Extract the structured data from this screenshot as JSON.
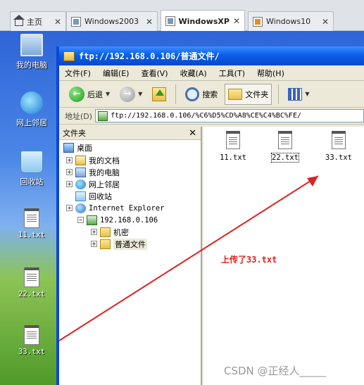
{
  "vm_tabs": [
    {
      "label": "主页",
      "icon": "home-icon"
    },
    {
      "label": "Windows2003",
      "icon": "vm-icon"
    },
    {
      "label": "WindowsXP",
      "icon": "vm-icon",
      "active": true
    },
    {
      "label": "Windows10",
      "icon": "vm-icon"
    }
  ],
  "desktop": {
    "icons": [
      "我的电脑",
      "网上邻居",
      "回收站",
      "11.txt",
      "22.txt",
      "33.txt"
    ]
  },
  "window": {
    "title": "ftp://192.168.0.106/普通文件/",
    "menu": [
      "文件(F)",
      "编辑(E)",
      "查看(V)",
      "收藏(A)",
      "工具(T)",
      "帮助(H)"
    ],
    "toolbar": {
      "back": "后退",
      "search": "搜索",
      "folders": "文件夹"
    },
    "address": {
      "label": "地址(D)",
      "value": "ftp://192.168.0.106/%C6%D5%CD%A8%CE%C4%BC%FE/"
    }
  },
  "tree": {
    "header": "文件夹",
    "nodes": [
      "桌面",
      "我的文档",
      "我的电脑",
      "网上邻居",
      "回收站",
      "Internet Explorer",
      "192.168.0.106",
      "机密",
      "普通文件"
    ]
  },
  "files": [
    "11.txt",
    "22.txt",
    "33.txt"
  ],
  "annotation": "上传了33.txt",
  "watermark": "CSDN @正经人_____",
  "colors": {
    "annotation": "#e02020",
    "titlebar": "#0a5fe8",
    "arrow": "#e02020"
  }
}
